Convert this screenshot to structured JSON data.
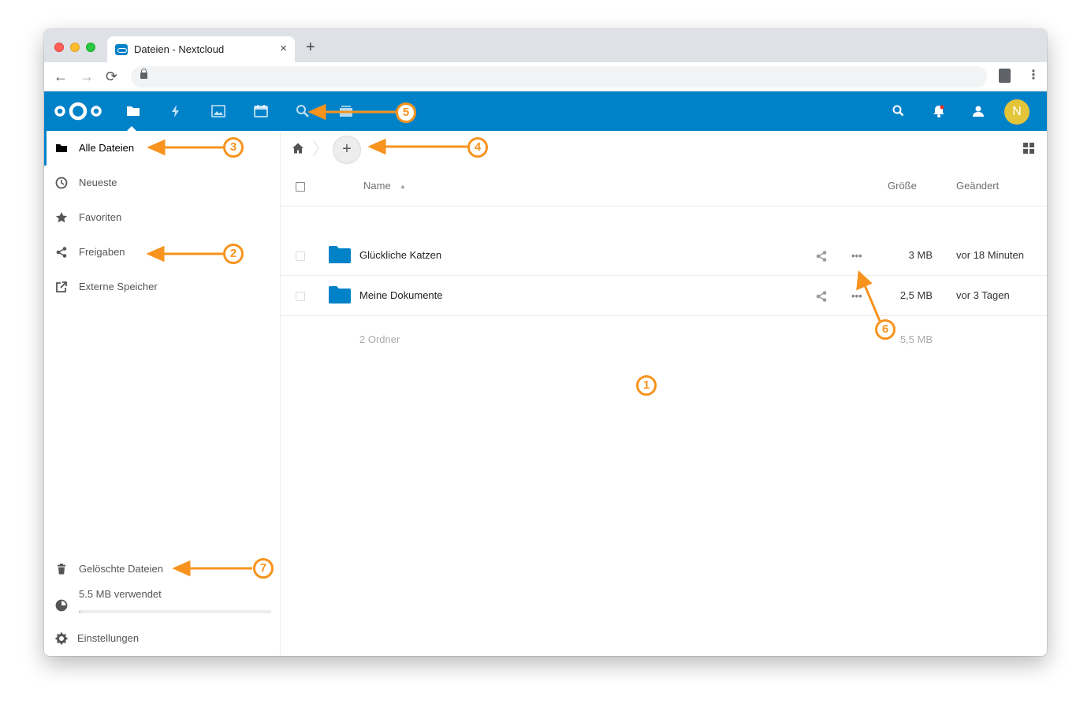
{
  "browser": {
    "tab_title": "Dateien - Nextcloud",
    "tab_close": "×",
    "new_tab": "+",
    "back": "←",
    "forward": "→",
    "reload": "⟳",
    "menu": "⋮"
  },
  "header": {
    "apps": [
      "files-icon",
      "activity-icon",
      "gallery-icon",
      "calendar-icon",
      "search-icon",
      "deck-icon"
    ],
    "right": [
      "search-icon",
      "notifications-icon",
      "contacts-icon"
    ],
    "avatar_initial": "N",
    "brand_color": "#0082c9"
  },
  "sidebar": {
    "items": [
      {
        "label": "Alle Dateien",
        "icon": "folder-icon",
        "active": true
      },
      {
        "label": "Neueste",
        "icon": "clock-icon"
      },
      {
        "label": "Favoriten",
        "icon": "star-icon"
      },
      {
        "label": "Freigaben",
        "icon": "share-icon"
      },
      {
        "label": "Externe Speicher",
        "icon": "external-link-icon"
      }
    ],
    "trash_label": "Gelöschte Dateien",
    "quota_label": "5.5 MB verwendet",
    "quota_fraction": 0.01,
    "settings_label": "Einstellungen"
  },
  "main": {
    "add_label": "+",
    "columns": {
      "name": "Name",
      "size": "Größe",
      "modified": "Geändert"
    },
    "sort_indicator": "▲",
    "rows": [
      {
        "name": "Glückliche Katzen",
        "size": "3 MB",
        "modified": "vor 18 Minuten"
      },
      {
        "name": "Meine Dokumente",
        "size": "2,5 MB",
        "modified": "vor 3 Tagen"
      }
    ],
    "more_label": "•••",
    "summary": {
      "count": "2 Ordner",
      "size": "5,5 MB"
    }
  },
  "callouts": [
    "1",
    "2",
    "3",
    "4",
    "5",
    "6",
    "7"
  ],
  "accent_color": "#f7931e"
}
